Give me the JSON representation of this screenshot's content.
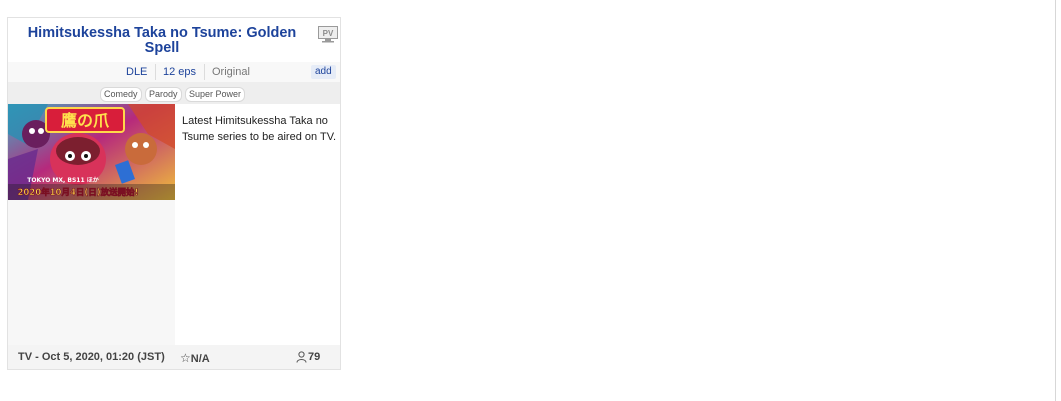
{
  "anime": {
    "title": "Himitsukessha Taka no Tsume: Golden Spell",
    "pv_label": "PV",
    "studio": "DLE",
    "episodes": "12 eps",
    "source": "Original",
    "add_label": "add",
    "genres": [
      "Comedy",
      "Parody",
      "Super Power"
    ],
    "synopsis": "Latest Himitsukessha Taka no Tsume series to be aired on TV.",
    "broadcast": "TV - Oct 5, 2020, 01:20 (JST)",
    "score": "N/A",
    "members": "79"
  },
  "poster": {
    "logo_text": "鷹の爪",
    "network_text": "TOKYO MX, BS11 ほか",
    "date_text": "2020年10月4日(日)放送開始!"
  },
  "icons": [
    "pv-icon",
    "star-icon",
    "user-icon"
  ]
}
